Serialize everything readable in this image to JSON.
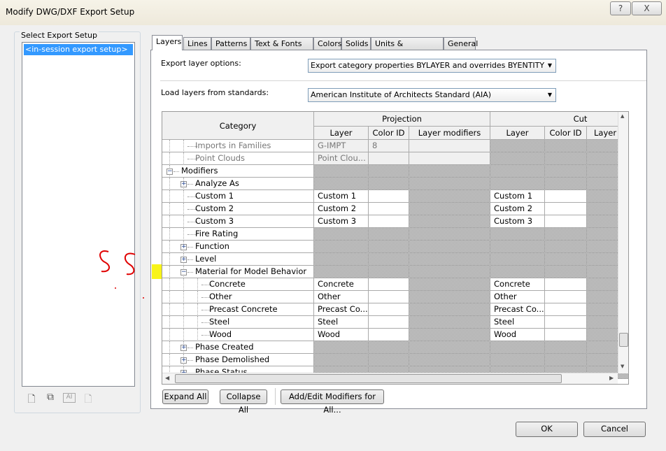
{
  "window": {
    "title": "Modify DWG/DXF Export Setup",
    "help": "?",
    "close": "X"
  },
  "left": {
    "group_label": "Select Export Setup",
    "items": [
      "<in-session export setup>"
    ],
    "icons": [
      "new-setup-icon",
      "duplicate-icon",
      "rename-icon",
      "delete-icon"
    ]
  },
  "tabs": [
    "Layers",
    "Lines",
    "Patterns",
    "Text & Fonts",
    "Colors",
    "Solids",
    "Units & Coordinates",
    "General"
  ],
  "layers": {
    "export_label": "Export layer options:",
    "export_value": "Export category properties BYLAYER and overrides BYENTITY",
    "load_label": "Load layers from standards:",
    "load_value": "American Institute of Architects Standard (AIA)",
    "headers": {
      "category": "Category",
      "projection": "Projection",
      "cut": "Cut",
      "layer": "Layer",
      "color_id": "Color ID",
      "layer_modifiers": "Layer modifiers",
      "cut_layer": "Layer",
      "cut_color_id": "Color ID",
      "cut_layer_mod": "Layer"
    },
    "rows": [
      {
        "name": "Imports in Families",
        "level": 1,
        "exp": "",
        "type": "dis",
        "layer": "G-IMPT",
        "color": "8",
        "cut_layer": ""
      },
      {
        "name": "Point Clouds",
        "level": 1,
        "exp": "",
        "type": "dis",
        "layer": "Point Clou...",
        "color": "",
        "cut_layer": ""
      },
      {
        "name": "Modifiers",
        "level": 0,
        "exp": "-",
        "type": "hat",
        "layer": "",
        "color": "",
        "cut_layer": ""
      },
      {
        "name": "Analyze As",
        "level": 1,
        "exp": "+",
        "type": "hat",
        "layer": "",
        "color": "",
        "cut_layer": ""
      },
      {
        "name": "Custom 1",
        "level": 1,
        "exp": "",
        "type": "val",
        "layer": "Custom 1",
        "color": "",
        "cut_layer": "Custom 1"
      },
      {
        "name": "Custom 2",
        "level": 1,
        "exp": "",
        "type": "val",
        "layer": "Custom 2",
        "color": "",
        "cut_layer": "Custom 2"
      },
      {
        "name": "Custom 3",
        "level": 1,
        "exp": "",
        "type": "val",
        "layer": "Custom 3",
        "color": "",
        "cut_layer": "Custom 3"
      },
      {
        "name": "Fire Rating",
        "level": 1,
        "exp": "",
        "type": "hat",
        "layer": "",
        "color": "",
        "cut_layer": ""
      },
      {
        "name": "Function",
        "level": 1,
        "exp": "+",
        "type": "hat",
        "layer": "",
        "color": "",
        "cut_layer": ""
      },
      {
        "name": "Level",
        "level": 1,
        "exp": "+",
        "type": "hat",
        "layer": "",
        "color": "",
        "cut_layer": ""
      },
      {
        "name": "Material for Model Behavior",
        "level": 1,
        "exp": "-",
        "type": "hat",
        "layer": "",
        "color": "",
        "cut_layer": ""
      },
      {
        "name": "Concrete",
        "level": 2,
        "exp": "",
        "type": "val",
        "layer": "Concrete",
        "color": "",
        "cut_layer": "Concrete"
      },
      {
        "name": "Other",
        "level": 2,
        "exp": "",
        "type": "val",
        "layer": "Other",
        "color": "",
        "cut_layer": "Other"
      },
      {
        "name": "Precast Concrete",
        "level": 2,
        "exp": "",
        "type": "val",
        "layer": "Precast Co...",
        "color": "",
        "cut_layer": "Precast Co..."
      },
      {
        "name": "Steel",
        "level": 2,
        "exp": "",
        "type": "val",
        "layer": "Steel",
        "color": "",
        "cut_layer": "Steel"
      },
      {
        "name": "Wood",
        "level": 2,
        "exp": "",
        "type": "val",
        "layer": "Wood",
        "color": "",
        "cut_layer": "Wood"
      },
      {
        "name": "Phase Created",
        "level": 1,
        "exp": "+",
        "type": "hat",
        "layer": "",
        "color": "",
        "cut_layer": ""
      },
      {
        "name": "Phase Demolished",
        "level": 1,
        "exp": "+",
        "type": "hat",
        "layer": "",
        "color": "",
        "cut_layer": ""
      },
      {
        "name": "Phase Status",
        "level": 1,
        "exp": "+",
        "type": "hat",
        "layer": "",
        "color": "",
        "cut_layer": ""
      }
    ],
    "expand_all": "Expand All",
    "collapse_all": "Collapse All",
    "add_edit": "Add/Edit Modifiers for All..."
  },
  "footer": {
    "ok": "OK",
    "cancel": "Cancel"
  },
  "colors": {
    "selection": "#3399ff",
    "highlight": "#f7f300",
    "annotation": "#e00000"
  }
}
